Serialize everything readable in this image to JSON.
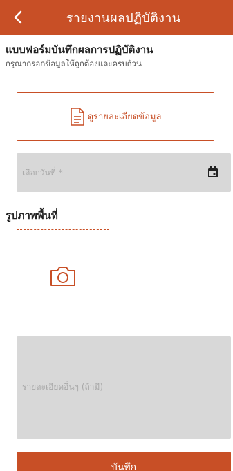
{
  "header": {
    "title": "รายงานผลปฏิบัติงาน",
    "back_icon": "chevron-left-icon"
  },
  "form": {
    "title": "แบบฟอร์มบันทึกผลการปฏิบัติงาน",
    "subtitle": "กรุณากรอกข้อมูลให้ถูกต้องและครบถ้วน",
    "detail_button_label": "ดูรายละเอียดข้อมูล",
    "detail_button_icon": "document-icon",
    "date_placeholder": "เลือกวันที่ *",
    "date_icon": "calendar-icon",
    "photo_section_label": "รูปภาพพื้นที่",
    "photo_icon": "camera-icon",
    "extra_placeholder": "รายละเอียดอื่นๆ (ถ้ามี)",
    "save_label": "บันทึก"
  },
  "colors": {
    "accent": "#c84f26",
    "field_bg": "#d8d8d8",
    "placeholder": "#a9a9a9"
  }
}
